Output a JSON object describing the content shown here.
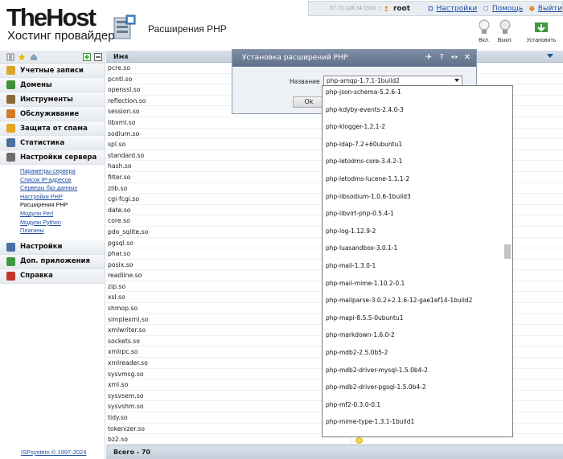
{
  "brand": {
    "name": "TheHost",
    "tagline": "Хостинг провайдер"
  },
  "page": {
    "title": "Расширения PHP"
  },
  "topbar": {
    "ip": "37.72.128.34:1500",
    "separator": "::",
    "user": "root",
    "settings": "Настройки",
    "help": "Помощь",
    "logout": "Выйти"
  },
  "tools": {
    "on": "Вкл.",
    "off": "Выкл.",
    "install": "Установить"
  },
  "sidebar": {
    "groups": [
      {
        "label": "Учетные записи",
        "color": "#d9a52b"
      },
      {
        "label": "Домены",
        "color": "#3f8f3a"
      },
      {
        "label": "Инструменты",
        "color": "#8a6a3a"
      },
      {
        "label": "Обслуживание",
        "color": "#d07a2a"
      },
      {
        "label": "Защита от спама",
        "color": "#e3a41f"
      },
      {
        "label": "Статистика",
        "color": "#4a6fa3"
      },
      {
        "label": "Настройки сервера",
        "color": "#6d6d6d"
      }
    ],
    "subitems": [
      "Параметры сервера",
      "Список IP-адресов",
      "Серверы баз данных",
      "Настройки PHP",
      "Расширения PHP",
      "Модули Perl",
      "Модули Python",
      "Плагины"
    ],
    "groups2": [
      {
        "label": "Настройки",
        "color": "#4a6fa3"
      },
      {
        "label": "Доп. приложения",
        "color": "#3f9a3f"
      },
      {
        "label": "Справка",
        "color": "#c0392b"
      }
    ],
    "copyright": "ISPsystem © 1997-2024"
  },
  "table": {
    "column": "Имя",
    "rows": [
      "pcre.so",
      "pcntl.so",
      "openssl.so",
      "reflection.so",
      "session.so",
      "libxml.so",
      "sodium.so",
      "spl.so",
      "standard.so",
      "hash.so",
      "filter.so",
      "zlib.so",
      "cgi-fcgi.so",
      "date.so",
      "core.so",
      "pdo_sqlite.so",
      "pgsql.so",
      "phar.so",
      "posix.so",
      "readline.so",
      "zip.so",
      "xsl.so",
      "shmop.so",
      "simplexml.so",
      "xmlwriter.so",
      "sockets.so",
      "xmlrpc.so",
      "xmlreader.so",
      "sysvmsg.so",
      "xml.so",
      "sysvsem.so",
      "sysvshm.so",
      "tidy.so",
      "tokenizer.so",
      "bz2.so"
    ],
    "footer": "Всего - 70"
  },
  "dialog": {
    "title": "Установка расширений PHP",
    "label": "Название",
    "selected": "php-amqp-1.7.1-1build2",
    "ok": "Ok",
    "options": [
      "php-json-schema-5.2.6-1",
      "php-kdyby-events-2.4.0-3",
      "php-klogger-1.2.1-2",
      "php-ldap-7.2+60ubuntu1",
      "php-letodms-core-3.4.2-1",
      "php-letodms-lucene-1.1.1-2",
      "php-libsodium-1.0.6-1build3",
      "php-libvirt-php-0.5.4-1",
      "php-log-1.12.9-2",
      "php-luasandbox-3.0.1-1",
      "php-mail-1.3.0-1",
      "php-mail-mime-1.10.2-0.1",
      "php-mailparse-3.0.2+2.1.6-12-gae1ef14-1build2",
      "php-mapi-8.5.5-0ubuntu1",
      "php-markdown-1.6.0-2",
      "php-mdb2-2.5.0b5-2",
      "php-mdb2-driver-mysql-1.5.0b4-2",
      "php-mdb2-driver-pgsql-1.5.0b4-2",
      "php-mf2-0.3.0-0.1",
      "php-mime-type-1.3.1-1build1"
    ]
  }
}
